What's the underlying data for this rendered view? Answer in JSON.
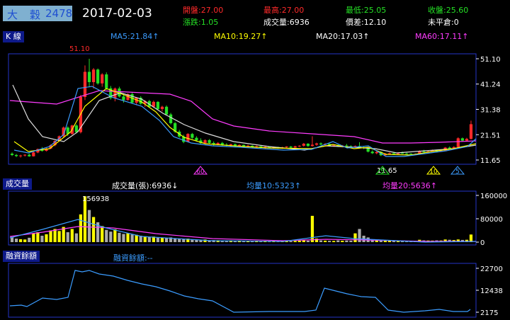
{
  "header": {
    "stock_name": [
      "大",
      "穀"
    ],
    "stock_code": "2478",
    "date": "2017-02-03",
    "open": "開盤:27.00",
    "high": "最高:27.00",
    "low": "最低:25.05",
    "close": "收盤:25.60",
    "change": "漲跌:1.05",
    "volume": "成交量:6936",
    "spread": "價差:12.10",
    "unsettled": "未平倉:0"
  },
  "kline": {
    "tag": "K 線",
    "ma5": "MA5:21.84↑",
    "ma10": "MA10:19.27↑",
    "ma20": "MA20:17.03↑",
    "ma60": "MA60:17.11↑",
    "y_ticks": [
      "51.10",
      "41.24",
      "31.38",
      "21.51",
      "11.65"
    ],
    "high_label": "51.10",
    "low_label": "11.65",
    "markers": [
      "60",
      "5",
      "10",
      "5"
    ]
  },
  "volume": {
    "tag": "成交量",
    "current": "成交量(張):6936↓",
    "ma10": "均量10:5323↑",
    "ma20": "均量20:5636↑",
    "peak_label": "156938",
    "y_ticks": [
      "160000",
      "80000",
      "0"
    ]
  },
  "margin": {
    "tag": "融資餘額",
    "current": "融資餘額:--",
    "y_ticks": [
      "22700",
      "12438",
      "2175"
    ]
  },
  "colors": {
    "up": "#ff2a2a",
    "down": "#25e025",
    "ma5": "#3b9cff",
    "ma10": "#ffff00",
    "ma20": "#dddddd",
    "ma60": "#ff3cff",
    "frame": "#2434c8"
  },
  "chart_data": [
    {
      "type": "candlestick",
      "title": "K 線",
      "ylim": [
        11.65,
        51.1
      ],
      "ohlc": [
        [
          14.1,
          14.6,
          13.2,
          13.6
        ],
        [
          13.6,
          14.0,
          12.8,
          13.2
        ],
        [
          13.2,
          13.7,
          12.6,
          13.4
        ],
        [
          13.4,
          13.9,
          13.0,
          13.7
        ],
        [
          13.7,
          14.2,
          12.9,
          13.1
        ],
        [
          13.1,
          15.0,
          13.0,
          14.6
        ],
        [
          14.6,
          16.1,
          14.3,
          15.9
        ],
        [
          15.9,
          16.7,
          14.9,
          15.2
        ],
        [
          15.2,
          16.4,
          15.0,
          16.1
        ],
        [
          16.1,
          17.7,
          15.9,
          17.4
        ],
        [
          17.4,
          19.3,
          17.0,
          19.1
        ],
        [
          19.1,
          21.2,
          18.8,
          20.9
        ],
        [
          20.9,
          24.7,
          20.5,
          24.3
        ],
        [
          24.3,
          24.8,
          21.0,
          21.8
        ],
        [
          21.8,
          25.4,
          21.5,
          25.1
        ],
        [
          25.1,
          25.6,
          22.0,
          22.5
        ],
        [
          22.5,
          37.0,
          22.0,
          36.2
        ],
        [
          36.2,
          48.5,
          35.0,
          46.0
        ],
        [
          46.0,
          51.1,
          40.0,
          42.0
        ],
        [
          42.0,
          47.5,
          39.5,
          46.9
        ],
        [
          46.9,
          47.3,
          41.0,
          41.5
        ],
        [
          41.5,
          45.5,
          40.2,
          45.0
        ],
        [
          45.0,
          45.8,
          39.0,
          39.6
        ],
        [
          39.6,
          40.5,
          35.2,
          35.8
        ],
        [
          35.8,
          39.9,
          34.5,
          39.5
        ],
        [
          39.5,
          40.2,
          36.0,
          36.4
        ],
        [
          36.4,
          37.5,
          34.0,
          35.0
        ],
        [
          35.0,
          37.6,
          34.8,
          37.3
        ],
        [
          37.3,
          38.0,
          33.5,
          34.0
        ],
        [
          34.0,
          36.2,
          33.0,
          35.9
        ],
        [
          35.9,
          36.5,
          33.2,
          33.6
        ],
        [
          33.6,
          35.0,
          32.3,
          34.6
        ],
        [
          34.6,
          35.1,
          32.0,
          32.4
        ],
        [
          32.4,
          34.8,
          32.0,
          34.3
        ],
        [
          34.3,
          34.6,
          31.0,
          31.5
        ],
        [
          31.5,
          32.8,
          30.6,
          32.4
        ],
        [
          32.4,
          32.9,
          29.0,
          29.4
        ],
        [
          29.4,
          30.0,
          25.5,
          26.0
        ],
        [
          26.0,
          26.5,
          22.2,
          22.7
        ],
        [
          22.7,
          23.4,
          20.3,
          20.8
        ],
        [
          20.8,
          21.5,
          18.2,
          18.7
        ],
        [
          18.7,
          22.1,
          18.5,
          21.8
        ],
        [
          21.8,
          22.2,
          19.9,
          20.3
        ],
        [
          20.3,
          20.9,
          18.8,
          19.3
        ],
        [
          19.3,
          20.1,
          17.7,
          18.2
        ],
        [
          18.2,
          19.7,
          18.0,
          19.4
        ],
        [
          19.4,
          19.8,
          17.9,
          18.3
        ],
        [
          18.3,
          18.9,
          17.3,
          17.7
        ],
        [
          17.7,
          18.6,
          17.4,
          18.3
        ],
        [
          18.3,
          18.7,
          17.2,
          17.6
        ],
        [
          17.6,
          18.2,
          17.0,
          17.4
        ],
        [
          17.4,
          18.0,
          16.9,
          17.8
        ],
        [
          17.8,
          18.1,
          16.8,
          17.1
        ],
        [
          17.1,
          17.8,
          16.7,
          17.5
        ],
        [
          17.5,
          17.7,
          16.6,
          16.9
        ],
        [
          16.9,
          17.6,
          16.6,
          17.2
        ],
        [
          17.2,
          17.4,
          16.3,
          16.6
        ],
        [
          16.6,
          17.3,
          16.3,
          17.0
        ],
        [
          17.0,
          17.1,
          16.1,
          16.4
        ],
        [
          16.4,
          17.0,
          16.0,
          16.8
        ],
        [
          16.8,
          16.9,
          16.2,
          16.5
        ],
        [
          16.5,
          16.9,
          16.1,
          16.7
        ],
        [
          16.7,
          16.8,
          16.0,
          16.3
        ],
        [
          16.3,
          16.8,
          16.0,
          16.6
        ],
        [
          16.6,
          17.0,
          16.2,
          16.9
        ],
        [
          16.9,
          17.1,
          16.3,
          16.5
        ],
        [
          16.5,
          17.2,
          16.4,
          17.0
        ],
        [
          17.0,
          17.4,
          16.7,
          17.2
        ],
        [
          17.2,
          18.3,
          16.9,
          18.0
        ],
        [
          18.0,
          18.2,
          16.8,
          17.1
        ],
        [
          17.1,
          20.9,
          16.9,
          17.6
        ],
        [
          17.6,
          18.4,
          17.2,
          18.1
        ],
        [
          18.1,
          18.5,
          17.4,
          17.7
        ],
        [
          17.7,
          18.2,
          17.2,
          17.9
        ],
        [
          17.9,
          18.1,
          16.9,
          17.2
        ],
        [
          17.2,
          17.6,
          16.8,
          17.4
        ],
        [
          17.4,
          17.7,
          16.7,
          17.0
        ],
        [
          17.0,
          17.5,
          16.6,
          17.3
        ],
        [
          17.3,
          17.9,
          16.9,
          17.0
        ],
        [
          17.0,
          17.4,
          16.5,
          16.8
        ],
        [
          16.8,
          17.3,
          16.4,
          17.1
        ],
        [
          17.1,
          18.6,
          16.3,
          16.6
        ],
        [
          16.6,
          16.9,
          15.9,
          16.2
        ],
        [
          16.2,
          16.5,
          14.6,
          14.9
        ],
        [
          14.9,
          15.4,
          14.0,
          14.3
        ],
        [
          14.3,
          15.1,
          13.9,
          14.8
        ],
        [
          14.8,
          15.0,
          13.2,
          13.5
        ],
        [
          13.5,
          14.4,
          13.3,
          14.1
        ],
        [
          14.1,
          14.6,
          13.8,
          14.3
        ],
        [
          14.3,
          14.7,
          13.9,
          14.0
        ],
        [
          14.0,
          14.6,
          13.8,
          14.4
        ],
        [
          14.4,
          14.9,
          14.0,
          14.2
        ],
        [
          14.2,
          14.5,
          13.9,
          14.1
        ],
        [
          14.1,
          14.3,
          13.7,
          13.9
        ],
        [
          13.9,
          14.2,
          13.6,
          14.0
        ],
        [
          14.0,
          15.4,
          13.8,
          15.1
        ],
        [
          15.1,
          15.6,
          14.5,
          14.8
        ],
        [
          14.8,
          15.3,
          14.6,
          15.0
        ],
        [
          15.0,
          15.7,
          14.9,
          15.4
        ],
        [
          15.4,
          15.5,
          14.7,
          14.9
        ],
        [
          14.9,
          15.6,
          14.8,
          15.3
        ],
        [
          15.3,
          16.7,
          15.2,
          16.5
        ],
        [
          16.5,
          16.9,
          15.9,
          16.1
        ],
        [
          16.1,
          17.0,
          15.8,
          16.7
        ],
        [
          16.7,
          20.5,
          16.5,
          20.1
        ],
        [
          20.1,
          20.4,
          18.8,
          19.2
        ],
        [
          19.2,
          20.3,
          18.9,
          19.9
        ],
        [
          19.9,
          27.0,
          19.6,
          25.6
        ]
      ]
    },
    {
      "type": "bar",
      "title": "成交量",
      "ylim": [
        0,
        160000
      ],
      "values": [
        18000,
        12000,
        10000,
        9000,
        15000,
        30000,
        34000,
        22000,
        27000,
        40000,
        45000,
        38000,
        52000,
        34000,
        45000,
        30000,
        95000,
        156938,
        110000,
        86000,
        68000,
        55000,
        42000,
        36000,
        44000,
        32000,
        28000,
        30000,
        26000,
        25000,
        22000,
        20000,
        18000,
        19000,
        17000,
        15000,
        14000,
        16000,
        12000,
        11000,
        10000,
        12000,
        9000,
        8000,
        7000,
        9000,
        6000,
        7000,
        6500,
        6000,
        5500,
        6000,
        5000,
        5500,
        5000,
        4800,
        4500,
        5000,
        4200,
        4400,
        4000,
        4300,
        3800,
        4100,
        4500,
        3900,
        4200,
        5000,
        6000,
        5000,
        90000,
        12000,
        6000,
        5000,
        4500,
        4000,
        6000,
        4800,
        5500,
        5000,
        30000,
        45000,
        22000,
        16000,
        9000,
        7000,
        8000,
        6000,
        5000,
        5200,
        4800,
        5000,
        4500,
        4600,
        4300,
        8000,
        6000,
        5500,
        5200,
        6000,
        5500,
        9000,
        8000,
        7000,
        9000,
        7500,
        8000,
        26000
      ]
    },
    {
      "type": "line",
      "title": "融資餘額",
      "ylim": [
        2175,
        22700
      ]
    }
  ]
}
